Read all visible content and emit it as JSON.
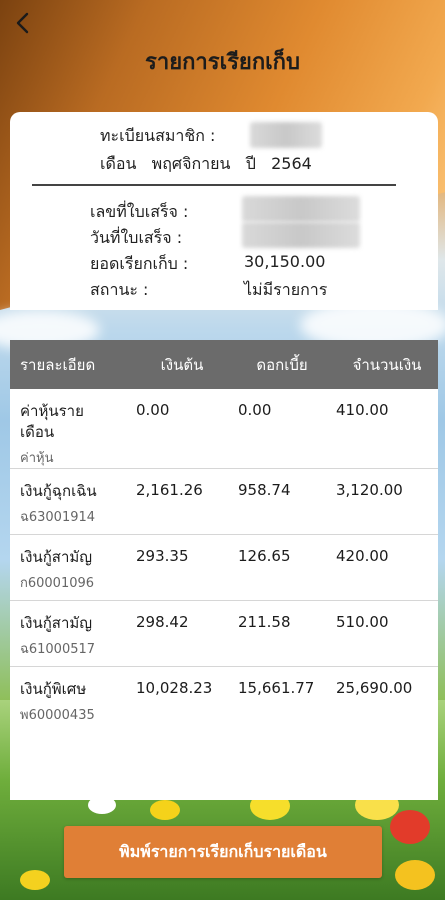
{
  "header": {
    "title": "รายการเรียกเก็บ"
  },
  "info": {
    "member_label": "ทะเบียนสมาชิก :",
    "month_label": "เดือน",
    "month_value": "พฤศจิกายน",
    "year_label": "ปี",
    "year_value": "2564",
    "receipt_no_label": "เลขที่ใบเสร็จ :",
    "receipt_date_label": "วันที่ใบเสร็จ :",
    "amount_label": "ยอดเรียกเก็บ :",
    "amount_value": "30,150.00",
    "status_label": "สถานะ :",
    "status_value": "ไม่มีรายการ"
  },
  "table": {
    "headers": [
      "รายละเอียด",
      "เงินต้น",
      "ดอกเบี้ย",
      "จำนวนเงิน"
    ],
    "rows": [
      {
        "label": "ค่าหุ้นรายเดือน",
        "label_line1": "ค่าหุ้นราย",
        "label_line2": "เดือน",
        "sub": "ค่าหุ้น",
        "principal": "0.00",
        "interest": "0.00",
        "amount": "410.00"
      },
      {
        "label": "เงินกู้ฉุกเฉิน",
        "sub": "ฉ63001914",
        "principal": "2,161.26",
        "interest": "958.74",
        "amount": "3,120.00"
      },
      {
        "label": "เงินกู้สามัญ",
        "sub": "ก60001096",
        "principal": "293.35",
        "interest": "126.65",
        "amount": "420.00"
      },
      {
        "label": "เงินกู้สามัญ",
        "sub": "ฉ61000517",
        "principal": "298.42",
        "interest": "211.58",
        "amount": "510.00"
      },
      {
        "label": "เงินกู้พิเศษ",
        "sub": "พ60000435",
        "principal": "10,028.23",
        "interest": "15,661.77",
        "amount": "25,690.00"
      }
    ]
  },
  "footer": {
    "print_button": "พิมพ์รายการเรียกเก็บรายเดือน"
  },
  "colors": {
    "header_gradient": "#c67a2a",
    "table_header": "#6b6b6b",
    "button": "#e07f36"
  },
  "icons": {
    "back": "chevron-left-icon"
  }
}
